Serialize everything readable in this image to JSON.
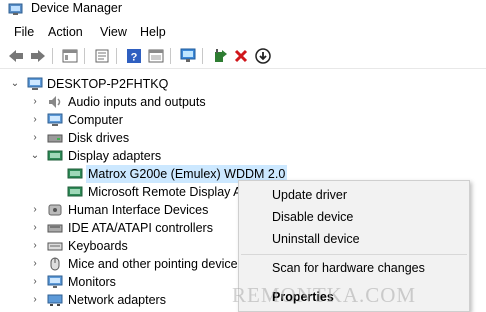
{
  "window": {
    "title": "Device Manager"
  },
  "menu": [
    "File",
    "Action",
    "View",
    "Help"
  ],
  "toolbar": {
    "buttons": [
      "back-icon",
      "forward-icon",
      "show-hide-tree-icon",
      "properties-icon",
      "help-icon",
      "details-icon",
      "monitor-scan-icon",
      "update-driver-icon",
      "uninstall-icon",
      "disable-icon"
    ]
  },
  "tree": {
    "root": "DESKTOP-P2FHTKQ",
    "items": [
      {
        "label": "Audio inputs and outputs",
        "icon": "speaker-icon"
      },
      {
        "label": "Computer",
        "icon": "computer-icon"
      },
      {
        "label": "Disk drives",
        "icon": "disk-drive-icon"
      },
      {
        "label": "Display adapters",
        "icon": "display-adapter-icon"
      },
      {
        "label": "Matrox G200e (Emulex) WDDM 2.0",
        "icon": "display-adapter-icon"
      },
      {
        "label": "Microsoft Remote Display Ac",
        "icon": "display-adapter-icon"
      },
      {
        "label": "Human Interface Devices",
        "icon": "hid-icon"
      },
      {
        "label": "IDE ATA/ATAPI controllers",
        "icon": "ide-controller-icon"
      },
      {
        "label": "Keyboards",
        "icon": "keyboard-icon"
      },
      {
        "label": "Mice and other pointing devices",
        "icon": "mouse-icon"
      },
      {
        "label": "Monitors",
        "icon": "monitor-icon"
      },
      {
        "label": "Network adapters",
        "icon": "network-adapter-icon"
      }
    ]
  },
  "context_menu": {
    "items": [
      "Update driver",
      "Disable device",
      "Uninstall device",
      "Scan for hardware changes",
      "Properties"
    ]
  },
  "watermark": "REMONTKA.COM"
}
